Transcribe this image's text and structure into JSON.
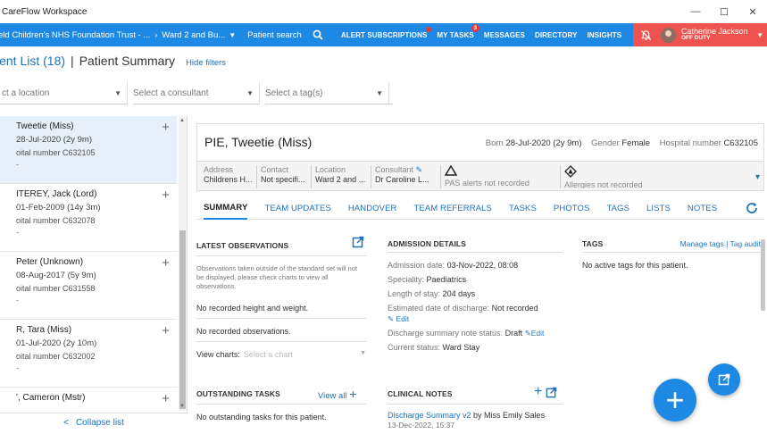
{
  "window": {
    "title": "CareFlow Workspace",
    "controls": {
      "minimize": "—",
      "maximize": "☐",
      "close": "✕"
    }
  },
  "nav": {
    "trust": "eld Children's NHS Foundation Trust - ...",
    "ward": "Ward 2 and Bu...",
    "patient_search": "Patient search",
    "links": [
      {
        "label": "ALERT SUBSCRIPTIONS",
        "badge": ""
      },
      {
        "label": "MY TASKS",
        "badge": "3"
      },
      {
        "label": "MESSAGES",
        "badge": ""
      },
      {
        "label": "DIRECTORY",
        "badge": ""
      },
      {
        "label": "INSIGHTS",
        "badge": ""
      }
    ],
    "user": {
      "name": "Catherine Jackson",
      "status": "OFF DUTY"
    },
    "colors": {
      "bar": "#1e88e5",
      "user_area": "#ef5350"
    }
  },
  "heading": {
    "list": "ient List (18)",
    "separator": "|",
    "summary": "Patient Summary",
    "hide_filters": "Hide filters"
  },
  "filters": {
    "location": "ct a location",
    "consultant": "Select a consultant",
    "tags": "Select a tag(s)"
  },
  "patients": [
    {
      "name": "Tweetie (Miss)",
      "dob": "28-Jul-2020 (2y 9m)",
      "number": "oital number C632105",
      "dash": "-",
      "selected": true
    },
    {
      "name": "ITEREY, Jack (Lord)",
      "dob": "01-Feb-2009 (14y 3m)",
      "number": "oital number C632078",
      "dash": "-",
      "selected": false
    },
    {
      "name": "Peter (Unknown)",
      "dob": "08-Aug-2017 (5y 9m)",
      "number": "oital number C631558",
      "dash": "-",
      "selected": false
    },
    {
      "name": "R, Tara (Miss)",
      "dob": "01-Jul-2020 (2y 10m)",
      "number": "oital number C632002",
      "dash": "-",
      "selected": false
    },
    {
      "name": "', Cameron (Mstr)",
      "dob": "",
      "number": "",
      "dash": "",
      "selected": false
    }
  ],
  "collapse_list": "Collapse list",
  "patient": {
    "name": "PIE, Tweetie (Miss)",
    "born_label": "Born",
    "born": "28-Jul-2020 (2y 9m)",
    "gender_label": "Gender",
    "gender": "Female",
    "hosp_label": "Hospital number",
    "hosp": "C632105",
    "details": {
      "address_label": "Address",
      "address": "Childrens H...",
      "contact_label": "Contact",
      "contact": "Not specifi...",
      "location_label": "Location",
      "location": "Ward 2 and ...",
      "consultant_label": "Consultant",
      "consultant": "Dr Caroline L...",
      "pas_alerts": "PAS alerts not recorded",
      "allergies": "Allergies not recorded"
    }
  },
  "tabs": [
    "SUMMARY",
    "TEAM UPDATES",
    "HANDOVER",
    "TEAM REFERRALS",
    "TASKS",
    "PHOTOS",
    "TAGS",
    "LISTS",
    "NOTES"
  ],
  "observations": {
    "title": "LATEST OBSERVATIONS",
    "note": "Observations taken outside of the standard set will not be displayed, please check charts to view all observations.",
    "no_hw": "No recorded height and weight.",
    "no_obs": "No recorded observations.",
    "view_charts_label": "View charts:",
    "view_charts_placeholder": "Select a chart"
  },
  "admission": {
    "title": "ADMISSION DETAILS",
    "date_label": "Admission date:",
    "date": "03-Nov-2022, 08:08",
    "specialty_label": "Speciality:",
    "specialty": "Paediatrics",
    "los_label": "Length of stay:",
    "los": "204 days",
    "edd_label": "Estimated date of discharge:",
    "edd": "Not recorded",
    "edit": "Edit",
    "dsn_label": "Discharge summary note status:",
    "dsn": "Draft",
    "status_label": "Current status:",
    "status": "Ward Stay"
  },
  "tags_card": {
    "title": "TAGS",
    "manage": "Manage tags | Tag audit",
    "none": "No active tags for this patient."
  },
  "outstanding": {
    "title": "OUTSTANDING TASKS",
    "view_all": "View all",
    "none": "No outstanding tasks for this patient."
  },
  "clinical": {
    "title": "CLINICAL NOTES",
    "note_title": "Discharge Summary v2",
    "note_by": "by Miss Emily Sales",
    "note_date": "13-Dec-2022, 15:37"
  }
}
